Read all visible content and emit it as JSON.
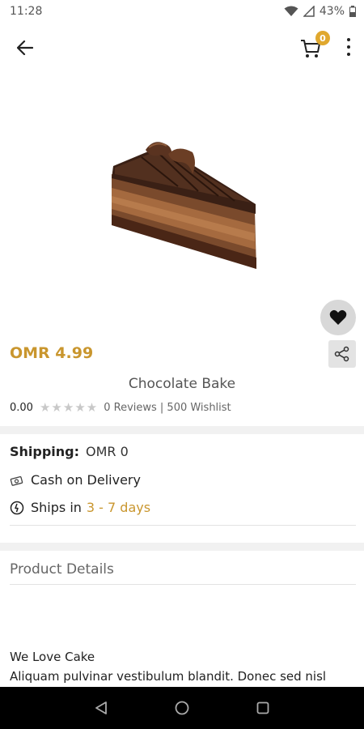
{
  "status_bar": {
    "time": "11:28",
    "battery": "43%"
  },
  "header": {
    "cart_count": "0"
  },
  "product": {
    "price": "OMR 4.99",
    "name": "Chocolate Bake",
    "rating": "0.00",
    "stars_filled": 0,
    "stars_total": 5,
    "reviews_wishlist": "0 Reviews | 500 Wishlist"
  },
  "shipping": {
    "label": "Shipping:",
    "value": "OMR 0",
    "cod_label": "Cash on Delivery",
    "ships_label": "Ships in",
    "ships_days": "3 - 7 days"
  },
  "details": {
    "heading": "Product Details",
    "desc_title": "We Love Cake",
    "desc_text": "Aliquam pulvinar vestibulum blandit. Donec sed nisl"
  },
  "colors": {
    "accent": "#c9962e",
    "badge": "#e0a82e",
    "star_empty": "#c8c8c8"
  },
  "icons": {
    "back": "arrow-left-icon",
    "cart": "cart-icon",
    "more": "more-vertical-icon",
    "wishlist": "heart-icon",
    "share": "share-icon",
    "cod": "cash-icon",
    "ships": "clock-icon"
  }
}
